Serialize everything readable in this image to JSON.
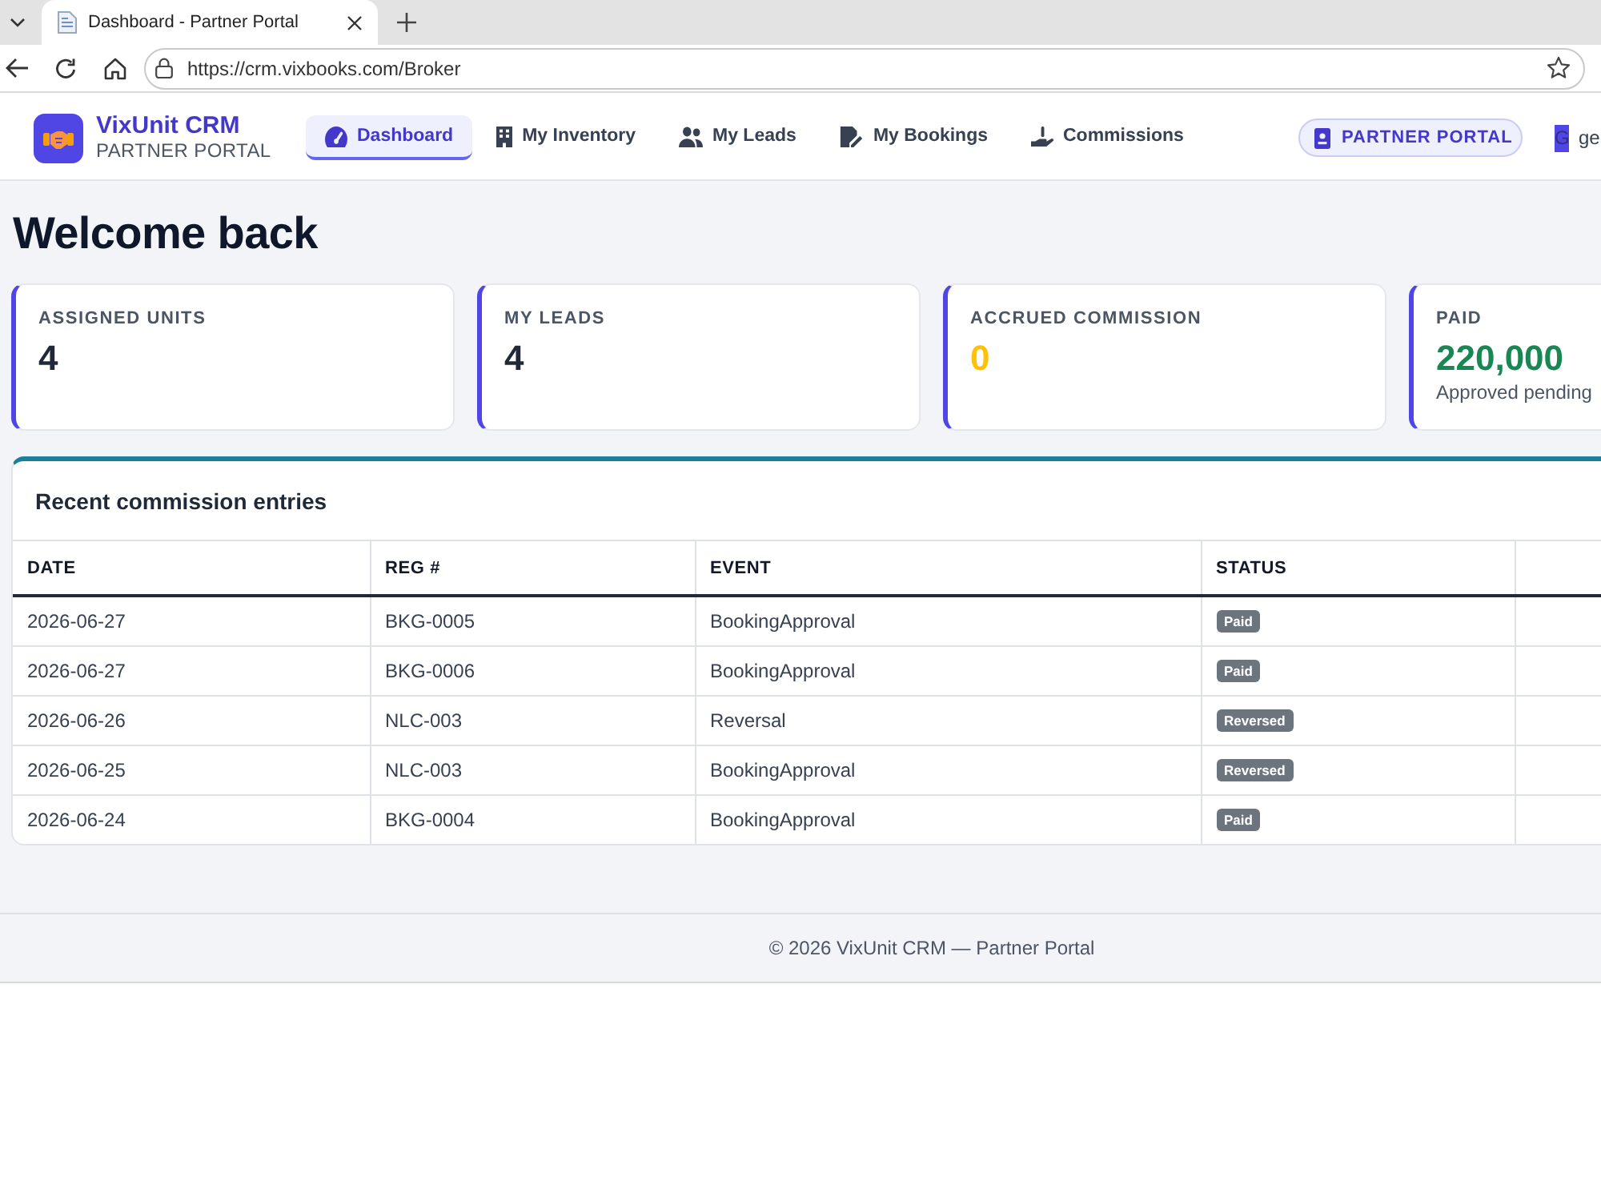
{
  "browser": {
    "tab": {
      "title": "Dashboard - Partner Portal"
    },
    "address": {
      "url": "https://crm.vixbooks.com/Broker"
    }
  },
  "navbar": {
    "brand": {
      "name": "VixUnit CRM",
      "subtitle": "PARTNER PORTAL"
    },
    "nav_items": [
      {
        "label": "Dashboard",
        "selected": true
      },
      {
        "label": "My Inventory",
        "selected": false
      },
      {
        "label": "My Leads",
        "selected": false
      },
      {
        "label": "My Bookings",
        "selected": false
      },
      {
        "label": "Commissions",
        "selected": false
      }
    ],
    "role_badge": "PARTNER PORTAL",
    "user": {
      "initial": "G",
      "name": "ge"
    }
  },
  "page": {
    "title": "Welcome back"
  },
  "stats": [
    {
      "label": "ASSIGNED UNITS",
      "value": "4",
      "color": "#1f2937"
    },
    {
      "label": "MY LEADS",
      "value": "4",
      "color": "#1f2937"
    },
    {
      "label": "ACCRUED COMMISSION",
      "value": "0",
      "color": "#ffc107"
    },
    {
      "label": "PAID",
      "value": "220,000",
      "color": "#198754",
      "note": "Approved pending"
    }
  ],
  "commissions": {
    "title": "Recent commission entries",
    "columns": [
      "DATE",
      "REG #",
      "EVENT",
      "STATUS"
    ],
    "rows": [
      {
        "date": "2026-06-27",
        "reg": "BKG-0005",
        "event": "BookingApproval",
        "status": "Paid"
      },
      {
        "date": "2026-06-27",
        "reg": "BKG-0006",
        "event": "BookingApproval",
        "status": "Paid"
      },
      {
        "date": "2026-06-26",
        "reg": "NLC-003",
        "event": "Reversal",
        "status": "Reversed"
      },
      {
        "date": "2026-06-25",
        "reg": "NLC-003",
        "event": "BookingApproval",
        "status": "Reversed"
      },
      {
        "date": "2026-06-24",
        "reg": "BKG-0004",
        "event": "BookingApproval",
        "status": "Paid"
      }
    ]
  },
  "footer": {
    "text": "© 2026 VixUnit CRM — Partner Portal"
  }
}
